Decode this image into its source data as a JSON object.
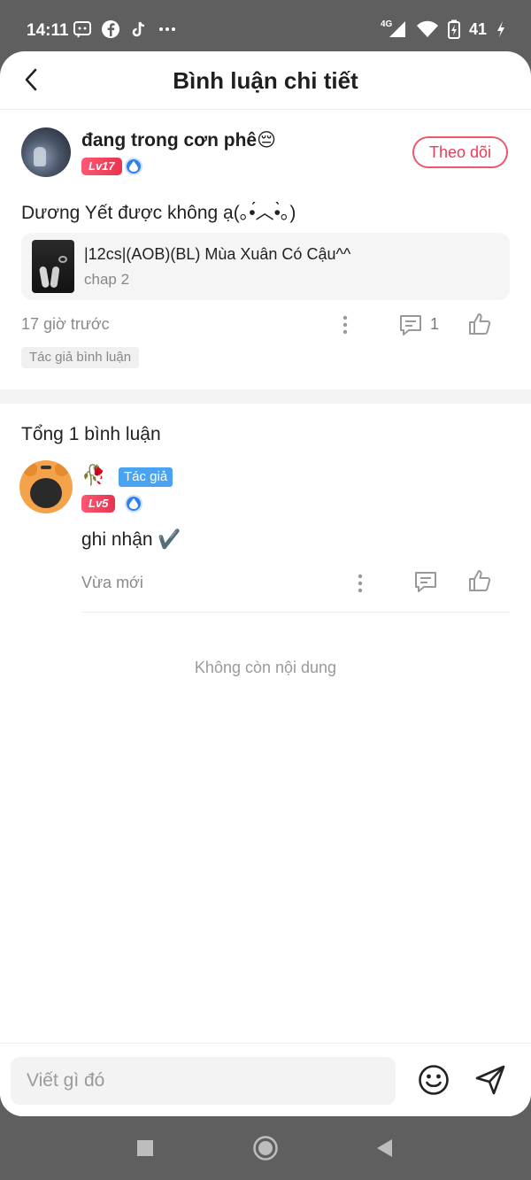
{
  "status_bar": {
    "time": "14:11",
    "network": "4G",
    "battery": "41",
    "icons": [
      "messenger-icon",
      "facebook-icon",
      "tiktok-icon",
      "more-dots-icon",
      "signal-icon",
      "wifi-icon",
      "battery-charging-icon"
    ]
  },
  "header": {
    "title": "Bình luận chi tiết",
    "back_icon": "chevron-left-icon"
  },
  "main_comment": {
    "username": "đang trong cơn phê😔",
    "level": "Lv17",
    "follow_label": "Theo dõi",
    "text": "Dương Yết được không ạ(｡•́︿•̀｡)",
    "story": {
      "title": "|12cs|(AOB)(BL) Mùa Xuân Có Cậu^^",
      "chapter": "chap 2"
    },
    "time": "17 giờ trước",
    "reply_count": "1",
    "tag": "Tác giả bình luận"
  },
  "replies_section": {
    "total_label": "Tổng 1 bình luận",
    "replies": [
      {
        "user_icon": "🥀",
        "author_badge": "Tác giả",
        "level": "Lv5",
        "text": "ghi nhận ✔️",
        "time": "Vừa mới"
      }
    ],
    "end_text": "Không còn nội dung"
  },
  "input_bar": {
    "placeholder": "Viết gì đó",
    "emoji_icon": "smiley-icon",
    "send_icon": "send-icon"
  },
  "nav_bar": {
    "icons": [
      "recents-square-icon",
      "home-circle-icon",
      "back-triangle-icon"
    ]
  },
  "colors": {
    "accent_pink": "#e83d57",
    "level_badge": "#f0566c",
    "author_badge": "#4aa3f0",
    "text_primary": "#222222",
    "text_secondary": "#8a8a8a"
  }
}
